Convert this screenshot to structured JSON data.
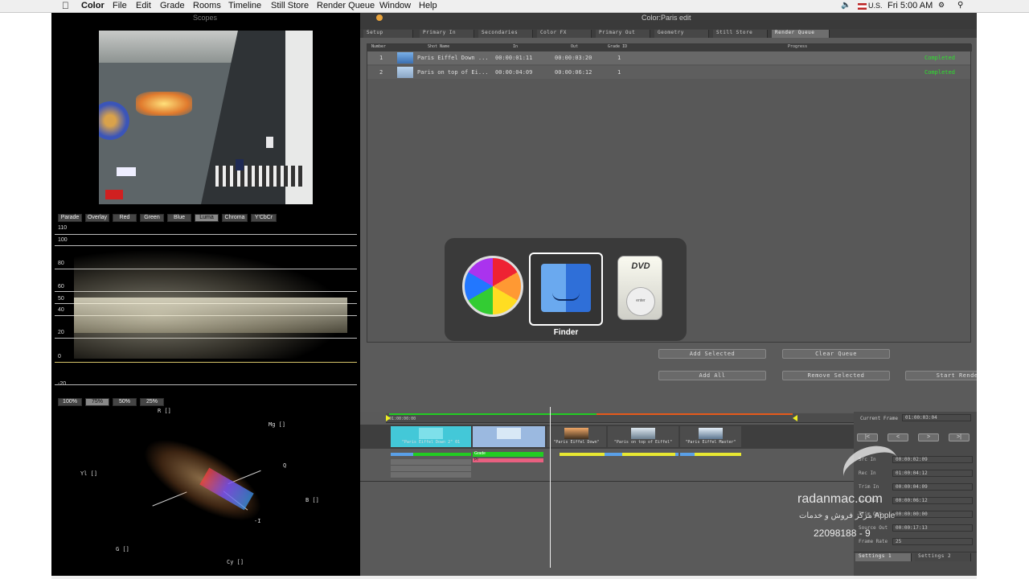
{
  "menubar": {
    "apple_icon": "apple-icon",
    "app_name": "Color",
    "menus": [
      "File",
      "Edit",
      "Grade",
      "Rooms",
      "Timeline",
      "Still Store",
      "Render Queue",
      "Window",
      "Help"
    ],
    "locale": "U.S.",
    "clock": "Fri 5:00 AM"
  },
  "window": {
    "title": "Color:Paris edit",
    "scopes_label": "Scopes"
  },
  "scope_buttons": [
    "Parade",
    "Overlay",
    "Red",
    "Green",
    "Blue",
    "Luma",
    "Chroma",
    "Y'CbCr"
  ],
  "active_scope": "Luma",
  "waveform_labels": [
    "110",
    "100",
    "80",
    "60",
    "50",
    "40",
    "20",
    "0",
    "-20"
  ],
  "zoom_buttons": [
    "100%",
    "75%",
    "50%",
    "25%"
  ],
  "active_zoom": "75%",
  "vectorscope_labels": {
    "r": "R []",
    "mg": "Mg []",
    "yl": "Yl []",
    "q": "Q",
    "b": "B []",
    "i": "-I",
    "g": "G []",
    "cy": "Cy []"
  },
  "rooms_tabs": [
    "Setup",
    "Primary In",
    "Secondaries",
    "Color FX",
    "Primary Out",
    "Geometry",
    "Still Store",
    "Render Queue"
  ],
  "active_tab": "Render Queue",
  "queue": {
    "headers": [
      "Number",
      "Shot Name",
      "In",
      "Out",
      "Grade ID",
      "Progress"
    ],
    "rows": [
      {
        "number": "1",
        "name": "Paris Eiffel Down ...",
        "in": "00:00:01:11",
        "out": "00:00:03:20",
        "grade": "1",
        "status": "Completed"
      },
      {
        "number": "2",
        "name": "Paris on top of Ei...",
        "in": "00:00:04:09",
        "out": "00:00:06:12",
        "grade": "1",
        "status": "Completed"
      }
    ]
  },
  "app_switcher": {
    "selected_label": "Finder",
    "apps": [
      "color-wheel-icon",
      "finder-icon",
      "dvd-player-icon"
    ],
    "dvd_text": "DVD",
    "enter_text": "enter"
  },
  "queue_buttons": {
    "add_selected": "Add Selected",
    "clear_queue": "Clear Queue",
    "add_all": "Add All",
    "remove_selected": "Remove Selected",
    "start_render": "Start Render"
  },
  "timeline": {
    "start_tc": "01:00:00:00",
    "clips": [
      "\"Paris Eiffel Down 2\" 01",
      "",
      "\"Paris Eiffel Down\"",
      "\"Paris on top of Eiffel\"",
      "\"Paris Eiffel Master\""
    ],
    "grade_label": "Grade",
    "pr_label": "Pr"
  },
  "transport": {
    "current_frame_label": "Current Frame",
    "current_frame": "01:00:03:04",
    "nav": [
      "|<",
      "<",
      ">",
      ">|"
    ],
    "fields": [
      {
        "label": "Src In",
        "value": "00:00:02:09"
      },
      {
        "label": "Rec In",
        "value": "01:00:04:12"
      },
      {
        "label": "Trim In",
        "value": "00:00:04:09"
      },
      {
        "label": "Src Out",
        "value": "00:00:06:12"
      },
      {
        "label": "Trim Out",
        "value": "00:00:00:00"
      },
      {
        "label": "Source Out",
        "value": "00:00:17:13"
      },
      {
        "label": "Frame Rate",
        "value": "25"
      }
    ],
    "settings_tabs": [
      "Settings 1",
      "Settings 2"
    ]
  },
  "watermark": {
    "brand": "radanmac.com",
    "tagline": "مرکز فروش و خدمات Apple",
    "phone": "22098188 - 9"
  },
  "colors": {
    "completed": "#2ee12e",
    "accent_cyan": "#39d5e0",
    "bar_green": "#22cc22",
    "bar_yellow": "#e8e832",
    "bar_blue": "#5aa0e8"
  }
}
